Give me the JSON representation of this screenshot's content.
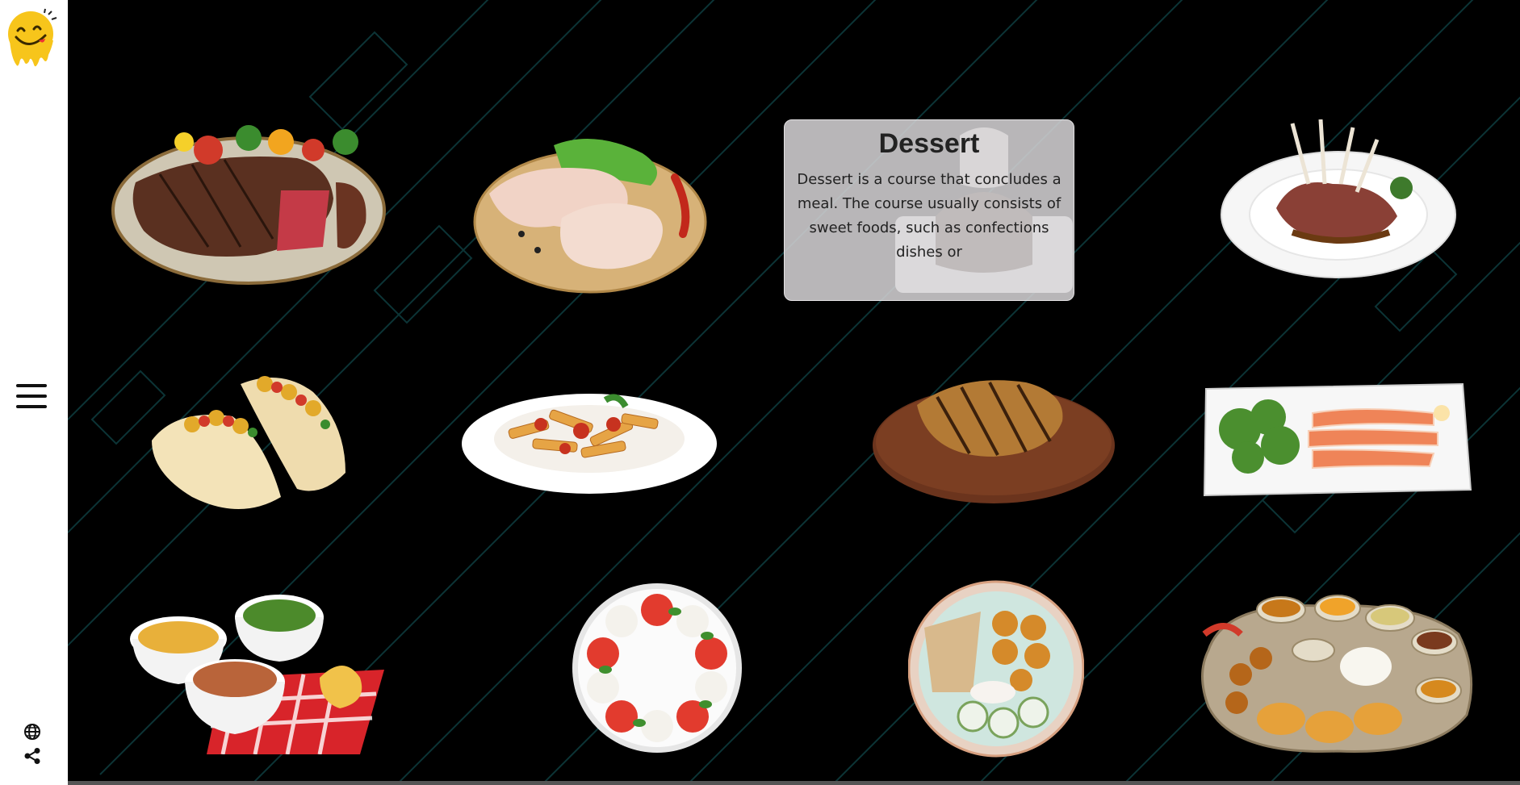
{
  "colors": {
    "sidebar_bg": "#ffffff",
    "stage_bg": "#000000",
    "accent_lines": "#0e3a3c",
    "info_card_bg": "#d6d4d6"
  },
  "sidebar": {
    "logo_icon": "smiley-drip-logo",
    "menu_icon": "hamburger-icon",
    "language_icon": "globe-icon",
    "share_icon": "share-icon"
  },
  "dishes": [
    {
      "id": "steak",
      "icon": "steak-plate"
    },
    {
      "id": "chicken",
      "icon": "raw-chicken-board"
    },
    {
      "id": "dessert",
      "icon": "dessert-plate"
    },
    {
      "id": "lamb",
      "icon": "lamb-chops-plate"
    },
    {
      "id": "tacos",
      "icon": "tacos"
    },
    {
      "id": "pasta",
      "icon": "penne-bowl"
    },
    {
      "id": "grilled-meat",
      "icon": "grilled-steak-board"
    },
    {
      "id": "salmon",
      "icon": "salmon-salad-platter"
    },
    {
      "id": "bowls",
      "icon": "side-dish-bowls"
    },
    {
      "id": "caprese",
      "icon": "caprese-plate"
    },
    {
      "id": "falafel",
      "icon": "falafel-bowl"
    },
    {
      "id": "thali",
      "icon": "thali-platter"
    }
  ],
  "info_card": {
    "title": "Dessert",
    "description": "Dessert is a course that concludes a meal. The course usually consists of sweet foods, such as confections dishes or"
  }
}
